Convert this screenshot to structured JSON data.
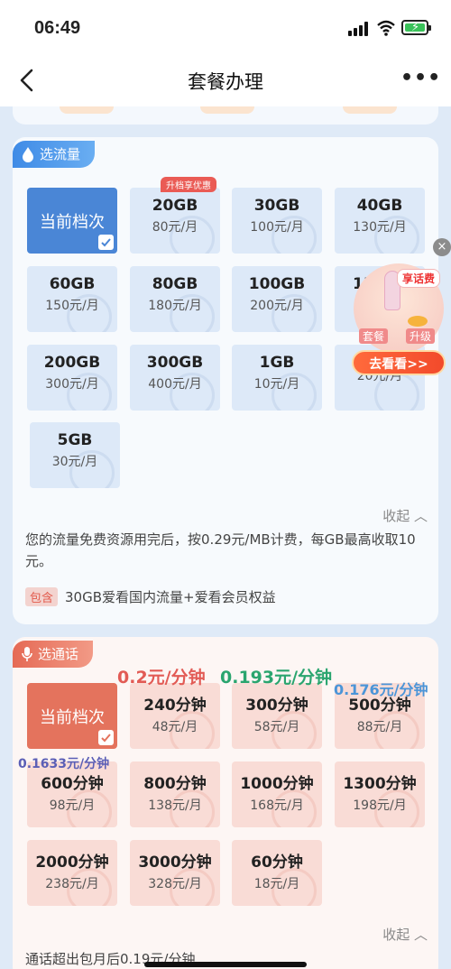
{
  "status_bar": {
    "time": "06:49"
  },
  "nav": {
    "title": "套餐办理",
    "back_icon": "chevron-left-icon",
    "more_label": "•••"
  },
  "data_section": {
    "tag": "选流量",
    "current_label": "当前档次",
    "hot_badge": "升档享优惠",
    "plans": [
      {
        "name": "20GB",
        "price": "80元/月"
      },
      {
        "name": "30GB",
        "price": "100元/月"
      },
      {
        "name": "40GB",
        "price": "130元/月"
      },
      {
        "name": "60GB",
        "price": "150元/月"
      },
      {
        "name": "80GB",
        "price": "180元/月"
      },
      {
        "name": "100GB",
        "price": "200元/月"
      },
      {
        "name": "150",
        "price": ""
      },
      {
        "name": "200GB",
        "price": "300元/月"
      },
      {
        "name": "300GB",
        "price": "400元/月"
      },
      {
        "name": "1GB",
        "price": "10元/月"
      },
      {
        "name": "",
        "price": "20元/月"
      },
      {
        "name": "5GB",
        "price": "30元/月"
      }
    ],
    "collapse": "收起",
    "note": "您的流量免费资源用完后，按0.29元/MB计费，每GB最高收取10元。",
    "include_badge": "包含",
    "include_text": "30GB爱看国内流量+爱看会员权益"
  },
  "promo": {
    "tag": "享话费",
    "word1": "套餐",
    "word2": "升级",
    "button": "去看看>>",
    "close": "×"
  },
  "call_section": {
    "tag": "选通话",
    "current_label": "当前档次",
    "plans": [
      {
        "name": "240分钟",
        "price": "48元/月"
      },
      {
        "name": "300分钟",
        "price": "58元/月"
      },
      {
        "name": "500分钟",
        "price": "88元/月"
      },
      {
        "name": "600分钟",
        "price": "98元/月"
      },
      {
        "name": "800分钟",
        "price": "138元/月"
      },
      {
        "name": "1000分钟",
        "price": "168元/月"
      },
      {
        "name": "1300分钟",
        "price": "198元/月"
      },
      {
        "name": "2000分钟",
        "price": "238元/月"
      },
      {
        "name": "3000分钟",
        "price": "328元/月"
      },
      {
        "name": "60分钟",
        "price": "18元/月"
      }
    ],
    "rate_notes": [
      "0.2元/分钟",
      "0.193元/分钟",
      "0.176元/分钟",
      "0.1633元/分钟"
    ],
    "collapse": "收起",
    "note": "通话超出包月后0.19元/分钟"
  },
  "colors": {
    "accent_blue": "#4a86d6",
    "accent_red": "#e4735d",
    "page_bg": "#dfeaf7"
  }
}
